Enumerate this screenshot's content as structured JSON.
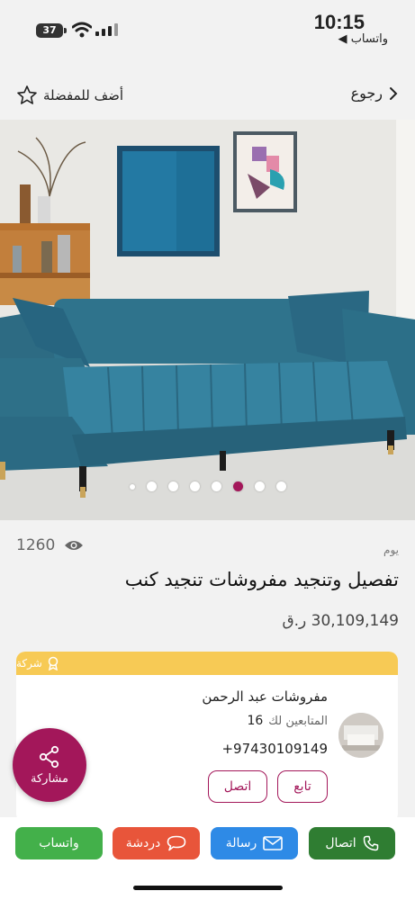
{
  "status_bar": {
    "time": "10:15",
    "battery": "37",
    "back_app": "◀ واتساب"
  },
  "nav": {
    "back_label": "رجوع",
    "favorite_label": "أضف للمفضلة"
  },
  "carousel": {
    "dots": [
      "small",
      "normal",
      "normal",
      "normal",
      "normal",
      "active",
      "normal",
      "normal"
    ]
  },
  "listing": {
    "views": "1260",
    "posted": "يوم",
    "title": "تفصيل وتنجيد مفروشات تنجيد كنب",
    "price": "30,109,149 ر.ق"
  },
  "seller": {
    "badge": "شركة",
    "name": "مفروشات عبد الرحمن",
    "followers_label": "المتابعين لك",
    "followers_count": "16",
    "phone": "+97430109149",
    "follow_label": "تابع",
    "call_label": "اتصل"
  },
  "share": {
    "label": "مشاركة"
  },
  "actions": {
    "call": "اتصال",
    "message": "رسالة",
    "chat": "دردشة",
    "whatsapp": "واتساب"
  },
  "colors": {
    "brand": "#a3175a",
    "seller_band": "#f7ca55",
    "call": "#2f7d32",
    "message": "#2e8ae6",
    "chat": "#e8553a",
    "whatsapp": "#43b04a"
  }
}
